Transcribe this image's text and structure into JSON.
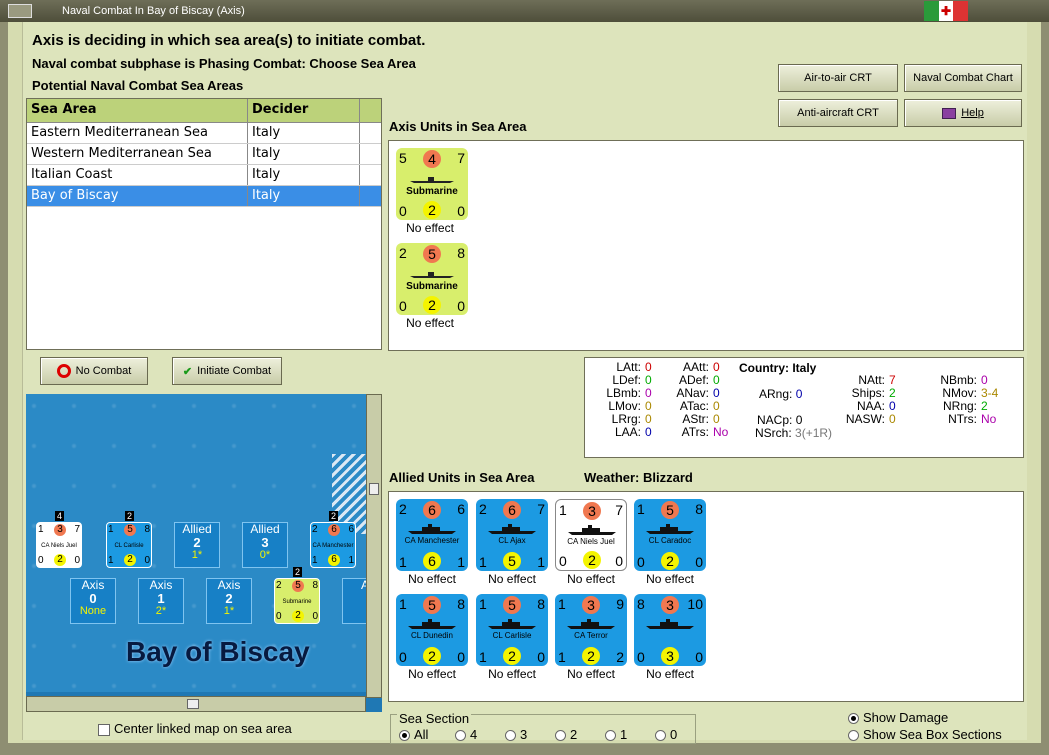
{
  "window": {
    "title": "Naval Combat In Bay of Biscay (Axis)"
  },
  "header": {
    "line1": "Axis is deciding in which sea area(s) to initiate combat.",
    "line2": "Naval combat subphase is Phasing Combat: Choose Sea Area",
    "line3": "Potential Naval Combat Sea Areas"
  },
  "buttons": {
    "air_to_air": "Air-to-air CRT",
    "naval_chart": "Naval Combat Chart",
    "anti_aircraft": "Anti-aircraft CRT",
    "help": "Help",
    "no_combat": "No Combat",
    "initiate_combat": "Initiate Combat"
  },
  "sea_table": {
    "headers": [
      "Sea Area",
      "Decider"
    ],
    "rows": [
      {
        "area": "Eastern Mediterranean Sea",
        "decider": "Italy"
      },
      {
        "area": "Western Mediterranean Sea",
        "decider": "Italy"
      },
      {
        "area": "Italian Coast",
        "decider": "Italy"
      },
      {
        "area": "Bay of Biscay",
        "decider": "Italy"
      }
    ]
  },
  "axis_units": {
    "label": "Axis Units in Sea Area",
    "units": [
      {
        "tl": "5",
        "tc": "4",
        "tr": "7",
        "name": "Submarine",
        "bl": "0",
        "bc": "2",
        "br": "0",
        "effect": "No effect"
      },
      {
        "tl": "2",
        "tc": "5",
        "tr": "8",
        "name": "Submarine",
        "bl": "0",
        "bc": "2",
        "br": "0",
        "effect": "No effect"
      }
    ]
  },
  "stats": {
    "country_label": "Country: Italy",
    "col1": [
      [
        "LAtt:",
        "0"
      ],
      [
        "LDef:",
        "0"
      ],
      [
        "LBmb:",
        "0"
      ],
      [
        "LMov:",
        "0"
      ],
      [
        "LRrg:",
        "0"
      ],
      [
        "LAA:",
        "0"
      ]
    ],
    "col2": [
      [
        "AAtt:",
        "0"
      ],
      [
        "ADef:",
        "0"
      ],
      [
        "ANav:",
        "0"
      ],
      [
        "ATac:",
        "0"
      ],
      [
        "AStr:",
        "0"
      ],
      [
        "ATrs:",
        "No"
      ]
    ],
    "arng": [
      "ARng:",
      "0"
    ],
    "nacp": [
      "NACp:",
      "0"
    ],
    "nsrch": [
      "NSrch:",
      "3(+1R)"
    ],
    "col4": [
      [
        "NAtt:",
        "7"
      ],
      [
        "Ships:",
        "2"
      ],
      [
        "NAA:",
        "0"
      ],
      [
        "NASW:",
        "0"
      ]
    ],
    "col5": [
      [
        "NBmb:",
        "0"
      ],
      [
        "NMov:",
        "3-4"
      ],
      [
        "NRng:",
        "2"
      ],
      [
        "NTrs:",
        "No"
      ]
    ]
  },
  "allied_units": {
    "label": "Allied Units in Sea Area",
    "weather": "Weather:  Blizzard",
    "units": [
      {
        "tl": "2",
        "tc": "6",
        "tr": "6",
        "name": "CA Manchester",
        "bl": "1",
        "bc": "6",
        "br": "1",
        "effect": "No effect",
        "style": "blue"
      },
      {
        "tl": "2",
        "tc": "6",
        "tr": "7",
        "name": "CL Ajax",
        "bl": "1",
        "bc": "5",
        "br": "1",
        "effect": "No effect",
        "style": "blue"
      },
      {
        "tl": "1",
        "tc": "3",
        "tr": "7",
        "name": "CA Niels Juel",
        "bl": "0",
        "bc": "2",
        "br": "0",
        "effect": "No effect",
        "style": "white"
      },
      {
        "tl": "1",
        "tc": "5",
        "tr": "8",
        "name": "CL Caradoc",
        "bl": "0",
        "bc": "2",
        "br": "0",
        "effect": "No effect",
        "style": "blue"
      },
      {
        "tl": "1",
        "tc": "5",
        "tr": "8",
        "name": "CL Dunedin",
        "bl": "0",
        "bc": "2",
        "br": "0",
        "effect": "No effect",
        "style": "blue"
      },
      {
        "tl": "1",
        "tc": "5",
        "tr": "8",
        "name": "CL Carlisle",
        "bl": "1",
        "bc": "2",
        "br": "0",
        "effect": "No effect",
        "style": "blue"
      },
      {
        "tl": "1",
        "tc": "3",
        "tr": "9",
        "name": "CA Terror",
        "bl": "1",
        "bc": "2",
        "br": "2",
        "effect": "No effect",
        "style": "blue"
      },
      {
        "tl": "8",
        "tc": "3",
        "tr": "10",
        "name": "",
        "bl": "0",
        "bc": "3",
        "br": "0",
        "effect": "No effect",
        "style": "blue"
      }
    ]
  },
  "map": {
    "title": "Bay of Biscay",
    "allied_boxes": [
      {
        "side": "Allied",
        "num": "2",
        "val": "1*"
      },
      {
        "side": "Allied",
        "num": "3",
        "val": "0*"
      }
    ],
    "axis_boxes": [
      {
        "side": "Axis",
        "num": "0",
        "val": "None"
      },
      {
        "side": "Axis",
        "num": "1",
        "val": "2*"
      },
      {
        "side": "Axis",
        "num": "2",
        "val": "1*"
      },
      {
        "side": "A",
        "num": "",
        "val": ""
      }
    ],
    "units": [
      {
        "name": "CA Niels Juel",
        "tl": "1",
        "tc": "3",
        "tr": "7",
        "bl": "0",
        "bc": "2",
        "br": "0",
        "badge": "4"
      },
      {
        "name": "CL Carlisle",
        "tl": "1",
        "tc": "5",
        "tr": "8",
        "bl": "1",
        "bc": "2",
        "br": "0",
        "badge": "2"
      },
      {
        "name": "CA Manchester",
        "tl": "2",
        "tc": "6",
        "tr": "6",
        "bl": "1",
        "bc": "6",
        "br": "1",
        "badge": "2"
      },
      {
        "name": "Submarine",
        "tl": "2",
        "tc": "5",
        "tr": "8",
        "bl": "0",
        "bc": "2",
        "br": "0",
        "badge": "2"
      }
    ]
  },
  "footer": {
    "center_map": "Center linked map on sea area",
    "sea_section_label": "Sea Section",
    "sea_section_options": [
      "All",
      "4",
      "3",
      "2",
      "1",
      "0"
    ],
    "show_damage": "Show Damage",
    "show_sea_box": "Show Sea Box Sections"
  },
  "colors": {
    "accent": "#3a8ee6",
    "table_header": "#bcd27a",
    "allied_unit": "#1c9ae2",
    "axis_unit": "#d8ee6c",
    "attack": "#f07850",
    "defense": "#f4f400"
  }
}
